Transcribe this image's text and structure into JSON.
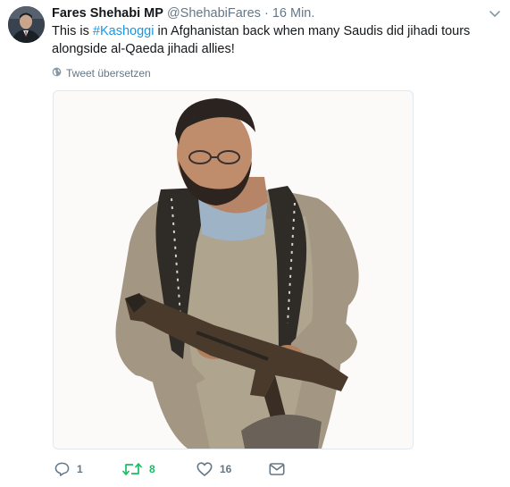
{
  "tweet": {
    "author_name": "Fares Shehabi MP",
    "handle": "@ShehabiFares",
    "separator": "·",
    "timestamp": "16 Min.",
    "text_before": "This is ",
    "hashtag": "#Kashoggi",
    "text_after": " in Afghanistan back when many Saudis did jihadi tours alongside al-Qaeda jihadi allies!",
    "translate_label": "Tweet übersetzen"
  },
  "actions": {
    "reply_count": "1",
    "retweet_count": "8",
    "like_count": "16"
  },
  "colors": {
    "link": "#1b95e0",
    "muted": "#657786",
    "retweet_active": "#17bf63"
  },
  "icons": [
    "chevron-down-icon",
    "globe-icon",
    "reply-icon",
    "retweet-icon",
    "like-icon",
    "direct-message-icon"
  ]
}
